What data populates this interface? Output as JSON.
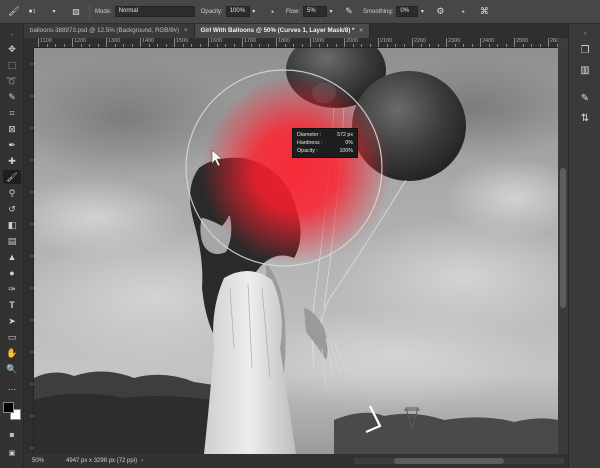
{
  "options_bar": {
    "mode_label": "Mode:",
    "mode_value": "Normal",
    "opacity_label": "Opacity:",
    "opacity_value": "100%",
    "flow_label": "Flow:",
    "flow_value": "5%",
    "smoothing_label": "Smoothing:",
    "smoothing_value": "0%",
    "brush_size": "1"
  },
  "tabs": [
    {
      "label": "balloons-388973.psd @ 12.5% (Background, RGB/8#)",
      "close": "×"
    },
    {
      "label": "Girl With Balloons @ 50% (Curves 1, Layer Mask/8) *",
      "close": "×"
    }
  ],
  "ruler": {
    "labels": [
      "1100",
      "1200",
      "1300",
      "1400",
      "1500",
      "1600",
      "1700",
      "1800",
      "1900",
      "2000",
      "2100",
      "2200",
      "2300",
      "2400",
      "2500",
      "2600"
    ]
  },
  "brush_info": {
    "diameter_label": "Diameter :",
    "diameter_value": "572 px",
    "hardness_label": "Hardness :",
    "hardness_value": "0%",
    "opacity_label": "Opacity :",
    "opacity_value": "100%"
  },
  "status_bar": {
    "zoom": "50%",
    "doc_size": "4947 px x 3298 px (72 ppi)"
  },
  "colors": {
    "foreground": "#000000",
    "background": "#ffffff",
    "brush_red": "#ff1e2d"
  }
}
